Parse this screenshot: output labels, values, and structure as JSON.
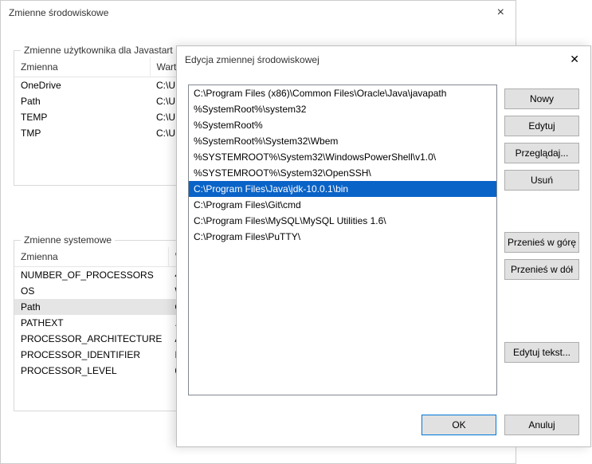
{
  "back_window": {
    "title": "Zmienne środowiskowe",
    "user_group": {
      "label": "Zmienne użytkownika dla Javastart",
      "columns": [
        "Zmienna",
        "Wartość"
      ],
      "rows": [
        {
          "name": "OneDrive",
          "value": "C:\\U"
        },
        {
          "name": "Path",
          "value": "C:\\U"
        },
        {
          "name": "TEMP",
          "value": "C:\\U"
        },
        {
          "name": "TMP",
          "value": "C:\\U"
        }
      ]
    },
    "sys_group": {
      "label": "Zmienne systemowe",
      "columns": [
        "Zmienna",
        "Wartość"
      ],
      "rows": [
        {
          "name": "NUMBER_OF_PROCESSORS",
          "value": "4"
        },
        {
          "name": "OS",
          "value": "Win"
        },
        {
          "name": "Path",
          "value": "C:\\P",
          "selected": true
        },
        {
          "name": "PATHEXT",
          "value": ".CO"
        },
        {
          "name": "PROCESSOR_ARCHITECTURE",
          "value": "AM"
        },
        {
          "name": "PROCESSOR_IDENTIFIER",
          "value": "Inte"
        },
        {
          "name": "PROCESSOR_LEVEL",
          "value": "6"
        }
      ]
    }
  },
  "front_window": {
    "title": "Edycja zmiennej środowiskowej",
    "list": [
      {
        "text": "C:\\Program Files (x86)\\Common Files\\Oracle\\Java\\javapath"
      },
      {
        "text": "%SystemRoot%\\system32"
      },
      {
        "text": "%SystemRoot%"
      },
      {
        "text": "%SystemRoot%\\System32\\Wbem"
      },
      {
        "text": "%SYSTEMROOT%\\System32\\WindowsPowerShell\\v1.0\\"
      },
      {
        "text": "%SYSTEMROOT%\\System32\\OpenSSH\\"
      },
      {
        "text": "C:\\Program Files\\Java\\jdk-10.0.1\\bin",
        "selected": true
      },
      {
        "text": "C:\\Program Files\\Git\\cmd"
      },
      {
        "text": "C:\\Program Files\\MySQL\\MySQL Utilities 1.6\\"
      },
      {
        "text": "C:\\Program Files\\PuTTY\\"
      }
    ],
    "buttons": {
      "new": "Nowy",
      "edit": "Edytuj",
      "browse": "Przeglądaj...",
      "delete": "Usuń",
      "move_up": "Przenieś w górę",
      "move_down": "Przenieś w dół",
      "edit_text": "Edytuj tekst..."
    },
    "ok": "OK",
    "cancel": "Anuluj"
  }
}
